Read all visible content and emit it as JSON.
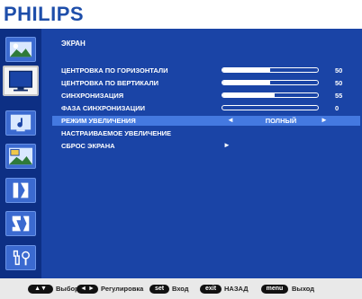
{
  "brand": {
    "logo": "PHILIPS"
  },
  "sidebar": {
    "items": [
      {
        "icon": "picture-icon"
      },
      {
        "icon": "screen-icon",
        "active": true
      },
      {
        "icon": "audio-icon"
      },
      {
        "icon": "pip-icon"
      },
      {
        "icon": "configuration-1-icon"
      },
      {
        "icon": "configuration-2-icon"
      },
      {
        "icon": "advanced-option-icon"
      }
    ]
  },
  "menu": {
    "title": "ЭКРАН",
    "items": [
      {
        "label": "ЦЕНТРОВКА ПО ГОРИЗОНТАЛИ",
        "value": "50",
        "level": 0.5
      },
      {
        "label": "ЦЕНТРОВКА ПО ВЕРТИКАЛИ",
        "value": "50",
        "level": 0.5
      },
      {
        "label": "СИНХРОНИЗАЦИЯ",
        "value": "55",
        "level": 0.55
      },
      {
        "label": "ФАЗА СИНХРОНИЗАЦИИ",
        "value": "0",
        "level": 0
      },
      {
        "label": "РЕЖИМ УВЕЛИЧЕНИЯ",
        "value": "ПОЛНЫЙ",
        "left_arrow": "◄",
        "right_arrow": "►"
      },
      {
        "label": "НАСТРАИВАЕМОЕ УВЕЛИЧЕНИЕ"
      },
      {
        "label": "СБРОС ЭКРАНА",
        "right_arrow": "►"
      }
    ]
  },
  "footer": {
    "hints": [
      {
        "key": "▲▼",
        "text": "Выбор"
      },
      {
        "key": "◄ ►",
        "text": "Регулировка"
      },
      {
        "key": "set",
        "text": "Вход"
      },
      {
        "key": "exit",
        "text": "НАЗАД"
      },
      {
        "key": "menu",
        "text": "Выход"
      }
    ]
  },
  "colors": {
    "menu_background": "#1a44a6",
    "sidebar_background": "#0d2f84",
    "selected_row": "#4479e0",
    "logo": "#1e4eaa"
  }
}
